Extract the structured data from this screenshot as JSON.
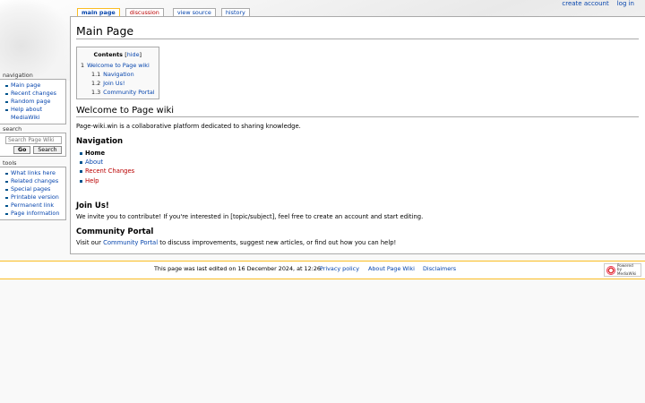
{
  "personal_tools": {
    "create_account": "create account",
    "log_in": "log in"
  },
  "tabs": [
    {
      "label": "main page"
    },
    {
      "label": "discussion"
    },
    {
      "label": "view source"
    },
    {
      "label": "history"
    }
  ],
  "page": {
    "title": "Main Page",
    "toc": {
      "title": "Contents",
      "hide": "hide",
      "items": [
        {
          "num": "1",
          "label": "Welcome to Page wiki"
        },
        {
          "num": "1.1",
          "label": "Navigation"
        },
        {
          "num": "1.2",
          "label": "Join Us!"
        },
        {
          "num": "1.3",
          "label": "Community Portal"
        }
      ]
    },
    "welcome": {
      "heading": "Welcome to Page wiki",
      "text": "Page-wiki.win is a collaborative platform dedicated to sharing knowledge."
    },
    "navigation": {
      "heading": "Navigation",
      "items": [
        "Home",
        "About",
        "Recent Changes",
        "Help"
      ]
    },
    "join": {
      "heading": "Join Us!",
      "text": "We invite you to contribute! If you're interested in [topic/subject], feel free to create an account and start editing."
    },
    "community": {
      "heading": "Community Portal",
      "text_before": "Visit our",
      "link": "Community Portal",
      "text_after": "to discuss improvements, suggest new articles, or find out how you can help!"
    }
  },
  "sidebar": {
    "navigation": {
      "title": "navigation",
      "items": [
        "Main page",
        "Recent changes",
        "Random page",
        "Help about MediaWiki"
      ]
    },
    "search": {
      "title": "search",
      "placeholder": "Search Page Wiki",
      "go": "Go",
      "search": "Search"
    },
    "tools": {
      "title": "tools",
      "items": [
        "What links here",
        "Related changes",
        "Special pages",
        "Printable version",
        "Permanent link",
        "Page information"
      ]
    }
  },
  "footer": {
    "last_edited": "This page was last edited on 16 December 2024, at 12:26.",
    "privacy": "Privacy policy",
    "about": "About Page Wiki",
    "disclaimers": "Disclaimers",
    "powered_line1": "Powered by",
    "powered_line2": "MediaWiki"
  },
  "colors": {
    "link": "#0645ad",
    "new_link": "#ba0000",
    "tab_selected_border": "#fabd23"
  }
}
